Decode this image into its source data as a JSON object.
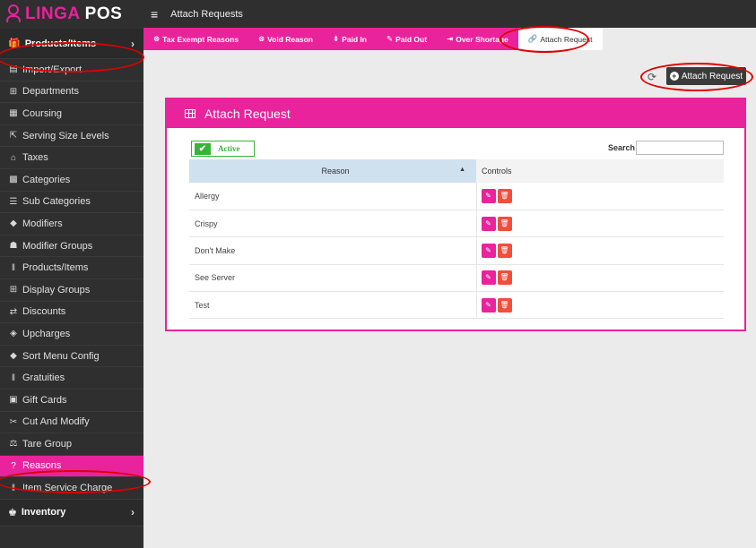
{
  "logo": {
    "part1": "LINGA",
    "part2": " POS"
  },
  "topbar": {
    "title": "Attach Requests"
  },
  "sidebar": {
    "parent_products": "Products/Items",
    "items": [
      {
        "label": "Import/Export",
        "icon": "▤"
      },
      {
        "label": "Departments",
        "icon": "⊞"
      },
      {
        "label": "Coursing",
        "icon": "▦"
      },
      {
        "label": "Serving Size Levels",
        "icon": "⇱"
      },
      {
        "label": "Taxes",
        "icon": "⌂"
      },
      {
        "label": "Categories",
        "icon": "▩"
      },
      {
        "label": "Sub Categories",
        "icon": "☰"
      },
      {
        "label": "Modifiers",
        "icon": "◆"
      },
      {
        "label": "Modifier Groups",
        "icon": "☗"
      },
      {
        "label": "Products/Items",
        "icon": "ǁ"
      },
      {
        "label": "Display Groups",
        "icon": "⊞"
      },
      {
        "label": "Discounts",
        "icon": "⇄"
      },
      {
        "label": "Upcharges",
        "icon": "◈"
      },
      {
        "label": "Sort Menu Config",
        "icon": "◆"
      },
      {
        "label": "Gratuities",
        "icon": "ǁ"
      },
      {
        "label": "Gift Cards",
        "icon": "▣"
      },
      {
        "label": "Cut And Modify",
        "icon": "✂"
      },
      {
        "label": "Tare Group",
        "icon": "⚖"
      },
      {
        "label": "Reasons",
        "icon": "?"
      },
      {
        "label": "Item Service Charge",
        "icon": "ǁ"
      }
    ],
    "parent_inventory": "Inventory"
  },
  "tabs": [
    {
      "label": "Tax Exempt Reasons",
      "icon": "⊗"
    },
    {
      "label": "Void Reason",
      "icon": "⊗"
    },
    {
      "label": "Paid In",
      "icon": "⇟"
    },
    {
      "label": "Paid Out",
      "icon": "✎"
    },
    {
      "label": "Over Shortage",
      "icon": "⇥"
    },
    {
      "label": "Attach Request",
      "icon": "🔗"
    }
  ],
  "toolbar": {
    "attach_label": "Attach Request"
  },
  "panel": {
    "title": "Attach Request",
    "active_label": "Active",
    "search_label": "Search",
    "search_value": "",
    "columns": [
      "Reason",
      "Controls"
    ],
    "rows": [
      "Allergy",
      "Crispy",
      "Don't Make",
      "See Server",
      "Test"
    ]
  },
  "colors": {
    "accent": "#e8239c",
    "sidebar": "#2f2f2f",
    "delete": "#f24e3a",
    "active": "#35b535"
  }
}
